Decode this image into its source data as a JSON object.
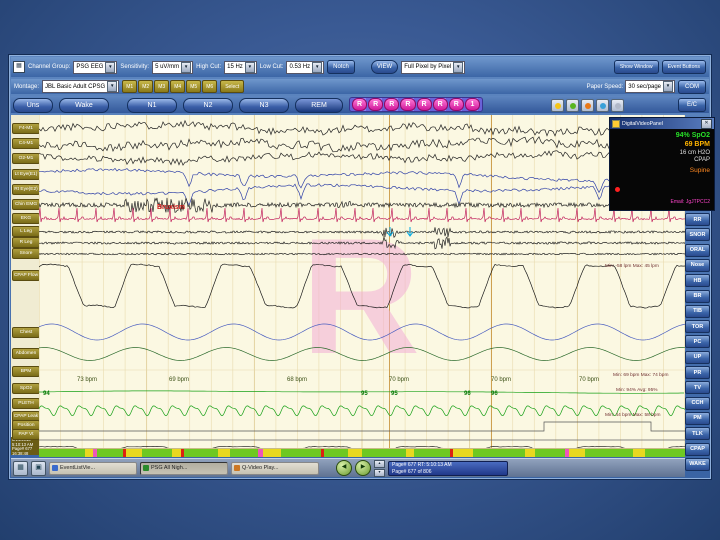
{
  "colors": {
    "window_blue": "#3f6bae",
    "chart_bg": "#fbf8e2",
    "ekg_pink": "#c2245e",
    "stage_pink": "#d0189a",
    "spo2_green": "#17a017",
    "eye_blue": "#3142a8",
    "abdomen_green": "#2d6b2d"
  },
  "icons": {
    "grid": "▦",
    "dropdown": "▼",
    "close": "✕",
    "prev": "◀",
    "next": "▶",
    "up": "▲",
    "down": "▼"
  },
  "toolbar": {
    "channel_group_label": "Channel Group:",
    "channel_group_value": "PSG EEG",
    "sensitivity_label": "Sensitivity:",
    "sensitivity_value": "5 uV/mm",
    "high_cut_label": "High Cut:",
    "high_cut_value": "15 Hz",
    "low_cut_label": "Low Cut:",
    "low_cut_value": "0.53 Hz",
    "notch_label": "Notch",
    "view_label": "VIEW",
    "view_mode_value": "Full Pixel by Pixel",
    "show_window_label": "Show Window",
    "event_buttons_label": "Event Buttons"
  },
  "montage_bar": {
    "montage_label": "Montage:",
    "montage_value": "JBL Basic Adult CPSG",
    "m_buttons": [
      "M1",
      "M2",
      "M3",
      "M4",
      "M5",
      "M6"
    ],
    "select_label": "Select",
    "paper_speed_label": "Paper Speed:",
    "paper_speed_value": "30 sec/page",
    "com_label": "COM",
    "ec_label": "E/C"
  },
  "stage_buttons": [
    "Uns",
    "Wake",
    "N1",
    "N2",
    "N3",
    "REM"
  ],
  "r_buttons": [
    "R",
    "R",
    "R",
    "R",
    "R",
    "R",
    "R",
    "1"
  ],
  "channels": [
    "F4-M1",
    "C4-M1",
    "O2-M1",
    "Lt Eye(E1)",
    "Rt Eye(E2)",
    "Chin EMG",
    "EKG",
    "L Leg",
    "R Leg",
    "Snore",
    "CPAP Flow",
    "Chest",
    "Abdomen",
    "BPM",
    "SpO2",
    "PLETH",
    "CPAP Leak",
    "Position",
    "PAP Vt"
  ],
  "right_buttons": [
    "RR",
    "SNOR",
    "ORAL",
    "Nose",
    "HB",
    "BR",
    "TIB",
    "TOR",
    "PC",
    "UP",
    "PR",
    "TV",
    "CCH",
    "PM",
    "TLK",
    "CPAP",
    "WAKE"
  ],
  "video_panel": {
    "title": "DigitalVideoPanel",
    "spo2": "94% SpO2",
    "bpm": "69 BPM",
    "pressure": "16 cm H2O",
    "pressure_mode": "CPAP",
    "position": "Supine",
    "footer": "Email: JgJTPCC2"
  },
  "annotations": {
    "bruxism": "Bruxism",
    "stage_watermark": "R",
    "hr_values": [
      "73 bpm",
      "69 bpm",
      "68 bpm",
      "70 bpm",
      "70 bpm",
      "70 bpm"
    ],
    "hr_minmax": "Min: 69 bpm  Max: 74 bpm",
    "spo2_values": [
      "94",
      "95",
      "95",
      "96",
      "96"
    ],
    "spo2_minmax": "Min: 94%  Avg: 95%",
    "flow_minmax": "Min: -58 lpm  Max: 45 lpm",
    "vt_minmax": "Min: 44 bpm  Max: 58 bpm"
  },
  "datetime_panel": [
    "8/14/2016",
    "5:10:13 AM",
    "Page# 677",
    "16:38:48"
  ],
  "taskbar": {
    "windows": [
      "EventListVie...",
      "PSG All Nigh...",
      "Q-Video Play..."
    ],
    "page_line1": "Page# 677   RT: 5:10:13 AM",
    "page_line2": "Page# 677 of 806"
  }
}
